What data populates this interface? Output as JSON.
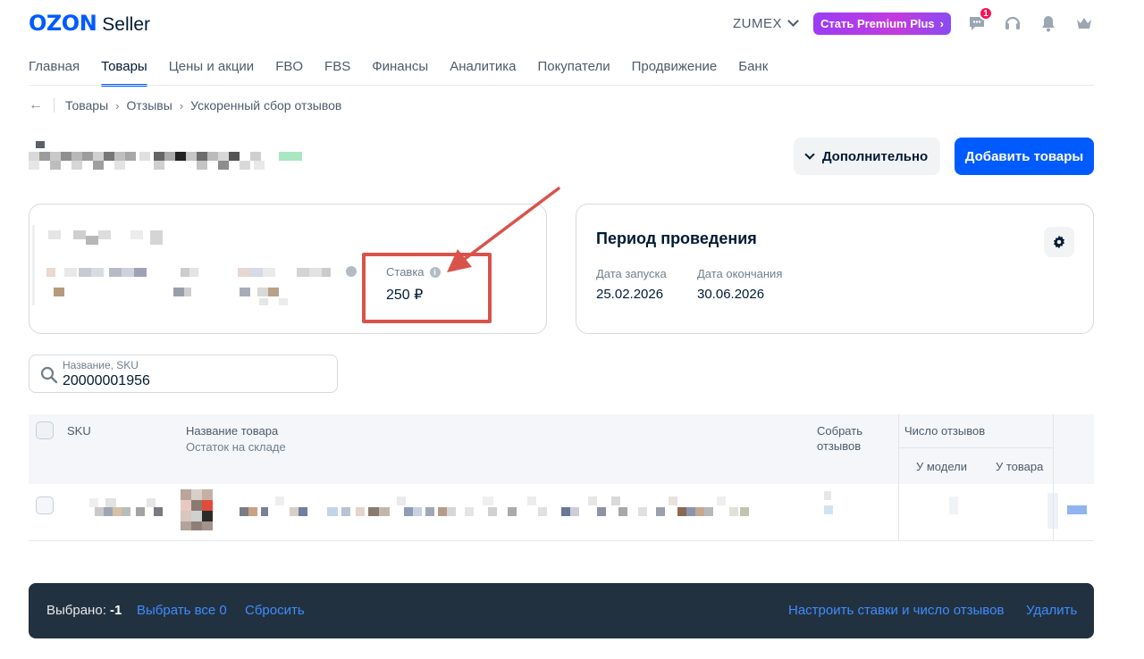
{
  "header": {
    "logo_brand": "OZON",
    "logo_product": "Seller",
    "account_name": "ZUMEX",
    "premium_label": "Стать Premium Plus",
    "premium_chevron": "›",
    "chat_badge": "1",
    "icons": [
      "chat-icon",
      "headset-icon",
      "bell-icon",
      "crown-icon"
    ]
  },
  "nav": {
    "items": [
      "Главная",
      "Товары",
      "Цены и акции",
      "FBO",
      "FBS",
      "Финансы",
      "Аналитика",
      "Покупатели",
      "Продвижение",
      "Банк"
    ],
    "active_index": 1
  },
  "breadcrumb": {
    "back_glyph": "←",
    "separator": "›",
    "items": [
      "Товары",
      "Отзывы",
      "Ускоренный сбор отзывов"
    ]
  },
  "actions": {
    "more_label": "Дополнительно",
    "add_label": "Добавить товары"
  },
  "promo_card": {
    "rate_label": "Ставка",
    "rate_value": "250 ₽",
    "info_glyph": "i"
  },
  "period_card": {
    "title": "Период проведения",
    "start_label": "Дата запуска",
    "start_value": "25.02.2026",
    "end_label": "Дата окончания",
    "end_value": "30.06.2026"
  },
  "search": {
    "placeholder": "Название, SKU",
    "value": "20000001956"
  },
  "table": {
    "col_sku": "SKU",
    "col_name": "Название товара",
    "col_name_sub": "Остаток на складе",
    "col_collect": "Собрать отзывов",
    "col_reviews": "Число отзывов",
    "col_reviews_model": "У модели",
    "col_reviews_product": "У товара"
  },
  "bottom_bar": {
    "selected_label": "Выбрано:",
    "selected_value": "-1",
    "select_all": "Выбрать все 0",
    "reset": "Сбросить",
    "configure": "Настроить ставки и число отзывов",
    "delete": "Удалить"
  },
  "colors": {
    "brand": "#005bff",
    "premium": "#b03ce8",
    "annotation": "#d9534a",
    "bottom_bar": "#22313f"
  }
}
